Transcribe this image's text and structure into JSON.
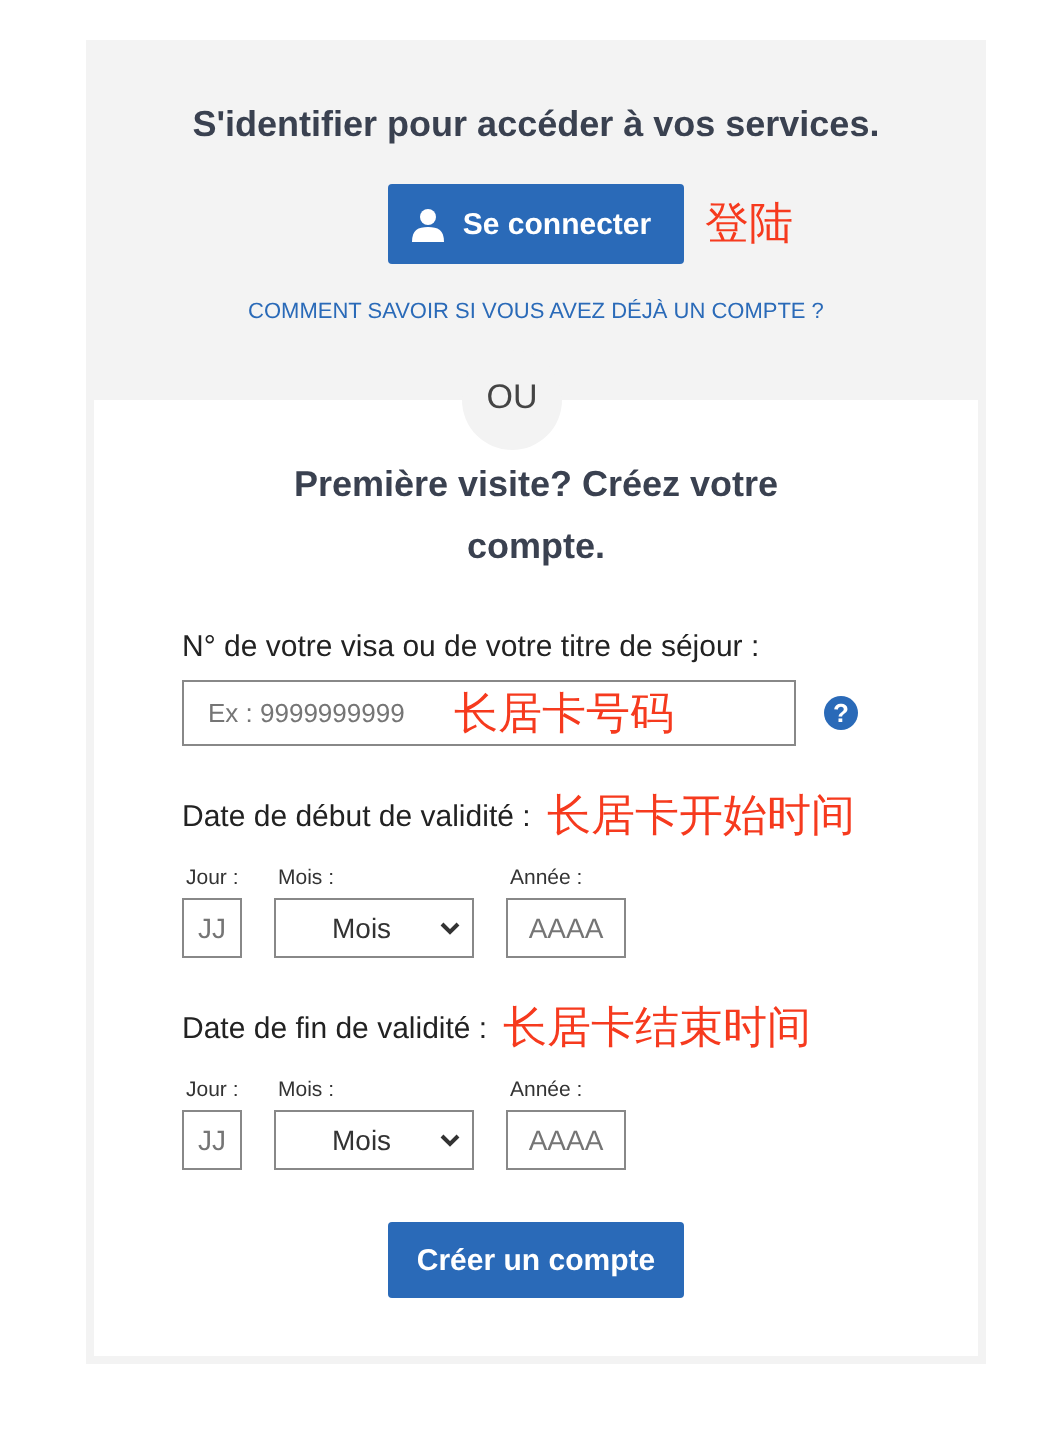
{
  "login": {
    "title": "S'identifier pour accéder à vos services.",
    "button": {
      "label": "Se connecter"
    },
    "annotation": "登陆",
    "help_link": "COMMENT SAVOIR SI VOUS AVEZ DÉJÀ UN COMPTE ?"
  },
  "separator": "OU",
  "signup": {
    "title": "Première visite? Créez votre compte.",
    "fields": [
      {
        "kind": "text",
        "label": "N° de votre visa ou de votre titre de séjour :",
        "placeholder": "Ex : 9999999999",
        "annotation": "长居卡号码",
        "help_icon": "?"
      },
      {
        "kind": "date",
        "label": "Date de début de validité :",
        "annotation": "长居卡开始时间",
        "parts": [
          {
            "kind": "input",
            "label": "Jour :",
            "placeholder": "JJ"
          },
          {
            "kind": "select",
            "label": "Mois :",
            "value": "Mois"
          },
          {
            "kind": "input",
            "label": "Année :",
            "placeholder": "AAAA"
          }
        ]
      },
      {
        "kind": "date",
        "label": "Date de fin de validité :",
        "annotation": "长居卡结束时间",
        "parts": [
          {
            "kind": "input",
            "label": "Jour :",
            "placeholder": "JJ"
          },
          {
            "kind": "select",
            "label": "Mois :",
            "value": "Mois"
          },
          {
            "kind": "input",
            "label": "Année :",
            "placeholder": "AAAA"
          }
        ]
      }
    ],
    "button": {
      "label": "Créer un compte"
    }
  }
}
